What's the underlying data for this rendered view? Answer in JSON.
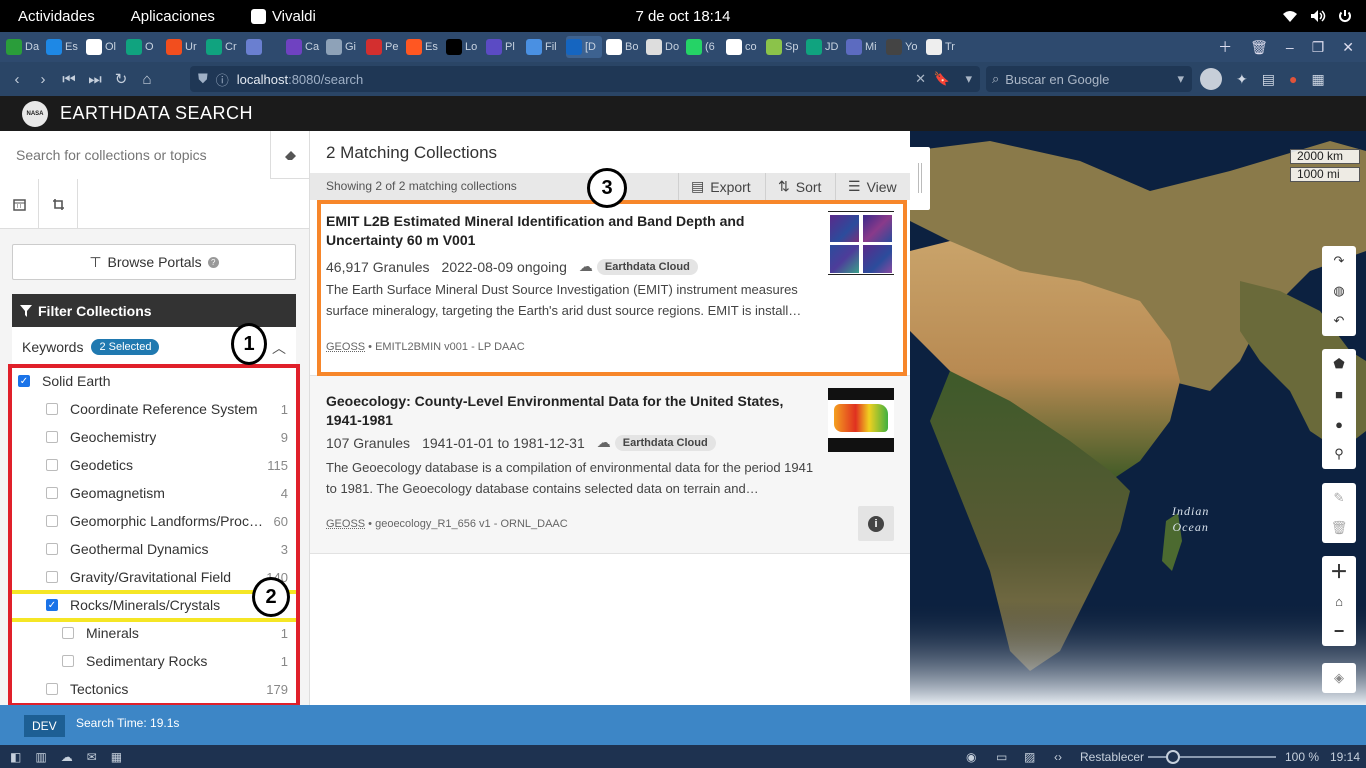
{
  "gnome": {
    "activities": "Actividades",
    "applications": "Aplicaciones",
    "app_name": "Vivaldi",
    "clock": "7 de oct  18:14"
  },
  "tabs": [
    {
      "label": "Da",
      "icon": "#2a9d3a"
    },
    {
      "label": "Es",
      "icon": "#1e88e5"
    },
    {
      "label": "Ol",
      "icon": "#ffffff"
    },
    {
      "label": "O",
      "icon": "#10a37f"
    },
    {
      "label": "Ur",
      "icon": "#f24e1e"
    },
    {
      "label": "Cr",
      "icon": "#10a37f"
    },
    {
      "label": "",
      "icon": "#6a7fd0"
    },
    {
      "label": "Ca",
      "icon": "#6f42c1"
    },
    {
      "label": "Gi",
      "icon": "#8ea2b8"
    },
    {
      "label": "Pe",
      "icon": "#d32f2f"
    },
    {
      "label": "Es",
      "icon": "#ff5722"
    },
    {
      "label": "Lo",
      "icon": "#000000"
    },
    {
      "label": "Pl",
      "icon": "#5b4bc4"
    },
    {
      "label": "Fil",
      "icon": "#4a90e2"
    },
    {
      "label": "[D",
      "icon": "#1565c0"
    },
    {
      "label": "Bo",
      "icon": "#ffffff"
    },
    {
      "label": "Do",
      "icon": "#dddddd"
    },
    {
      "label": "(6",
      "icon": "#25d366"
    },
    {
      "label": "co",
      "icon": "#ffffff"
    },
    {
      "label": "Sp",
      "icon": "#8bc34a"
    },
    {
      "label": "JD",
      "icon": "#10a37f"
    },
    {
      "label": "Mi",
      "icon": "#5c6bc0"
    },
    {
      "label": "Yo",
      "icon": "#444444"
    },
    {
      "label": "Tr",
      "icon": "#eeeeee"
    }
  ],
  "address": {
    "url_host": "localhost",
    "url_rest": ":8080/search",
    "search_placeholder": "Buscar en Google"
  },
  "app": {
    "brand": "EARTHDATA SEARCH",
    "nasa_label": "NASA"
  },
  "sidebar": {
    "search_placeholder": "Search for collections or topics",
    "browse_portals": "Browse Portals",
    "filter_title": "Filter Collections",
    "keywords_label": "Keywords",
    "keywords_badge": "2 Selected",
    "keywords": [
      {
        "label": "Solid Earth",
        "count": "",
        "checked": true,
        "level": 0
      },
      {
        "label": "Coordinate Reference System",
        "count": "1",
        "checked": false,
        "level": 1
      },
      {
        "label": "Geochemistry",
        "count": "9",
        "checked": false,
        "level": 1
      },
      {
        "label": "Geodetics",
        "count": "115",
        "checked": false,
        "level": 1
      },
      {
        "label": "Geomagnetism",
        "count": "4",
        "checked": false,
        "level": 1
      },
      {
        "label": "Geomorphic Landforms/Proc…",
        "count": "60",
        "checked": false,
        "level": 1
      },
      {
        "label": "Geothermal Dynamics",
        "count": "3",
        "checked": false,
        "level": 1
      },
      {
        "label": "Gravity/Gravitational Field",
        "count": "140",
        "checked": false,
        "level": 1
      },
      {
        "label": "Rocks/Minerals/Crystals",
        "count": "",
        "checked": true,
        "level": 1
      },
      {
        "label": "Minerals",
        "count": "1",
        "checked": false,
        "level": 2
      },
      {
        "label": "Sedimentary Rocks",
        "count": "1",
        "checked": false,
        "level": 2
      },
      {
        "label": "Tectonics",
        "count": "179",
        "checked": false,
        "level": 1
      }
    ]
  },
  "results": {
    "title": "2 Matching Collections",
    "showing": "Showing 2 of 2 matching collections",
    "export": "Export",
    "sort": "Sort",
    "view": "View",
    "items": [
      {
        "title": "EMIT L2B Estimated Mineral Identification and Band Depth and Uncertainty 60 m V001",
        "granules": "46,917 Granules",
        "dates": "2022-08-09 ongoing",
        "cloud": "Earthdata Cloud",
        "desc": "The Earth Surface Mineral Dust Source Investigation (EMIT) instrument measures surface mineralogy, targeting the Earth's arid dust source regions. EMIT is install…",
        "tag": "GEOSS",
        "foot": " • EMITL2BMIN v001 - LP DAAC"
      },
      {
        "title": "Geoecology: County-Level Environmental Data for the United States, 1941-1981",
        "granules": "107 Granules",
        "dates": "1941-01-01 to 1981-12-31",
        "cloud": "Earthdata Cloud",
        "desc": "The Geoecology database is a compilation of environmental data for the period 1941 to 1981. The Geoecology database contains selected data on terrain and…",
        "tag": "GEOSS",
        "foot": " • geoecology_R1_656 v1 - ORNL_DAAC"
      }
    ]
  },
  "map": {
    "scale_km": "2000 km",
    "scale_mi": "1000 mi",
    "ocean_line1": "Indian",
    "ocean_line2": "Ocean"
  },
  "annotations": [
    "1",
    "2",
    "3"
  ],
  "status": {
    "env": "DEV",
    "search_time": "Search Time: 19.1s"
  },
  "vivaldi_bottom": {
    "reset": "Restablecer",
    "zoom": "100 %",
    "time": "19:14"
  },
  "colors": {
    "annotation_red": "#e0202a",
    "annotation_yellow": "#f5e625",
    "annotation_orange": "#f7862a",
    "accent": "#2079b0",
    "status_blue": "#3d86c6"
  }
}
